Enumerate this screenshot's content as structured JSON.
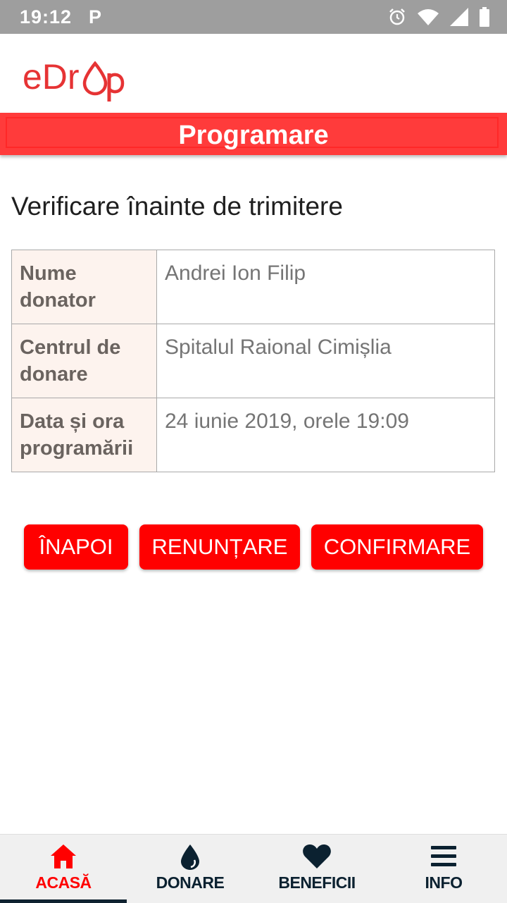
{
  "status_bar": {
    "time": "19:12",
    "notification": "P",
    "icons": [
      "alarm-icon",
      "wifi-icon",
      "signal-icon",
      "battery-icon"
    ]
  },
  "app": {
    "logo_text": "eDrop",
    "brand_color": "#e63334"
  },
  "page": {
    "title": "Programare",
    "heading": "Verificare înainte de trimitere"
  },
  "review": {
    "rows": [
      {
        "label": "Nume donator",
        "value": "Andrei Ion Filip"
      },
      {
        "label": "Centrul de donare",
        "value": "Spitalul Raional Cimișlia"
      },
      {
        "label": "Data și ora programării",
        "value": "24 iunie 2019, orele 19:09"
      }
    ]
  },
  "actions": {
    "back_label": "ÎNAPOI",
    "cancel_label": "RENUNȚARE",
    "confirm_label": "CONFIRMARE",
    "button_color": "#ff0000"
  },
  "bottom_nav": {
    "items": [
      {
        "label": "ACASĂ",
        "icon": "home-icon",
        "active": true
      },
      {
        "label": "DONARE",
        "icon": "drop-icon",
        "active": false
      },
      {
        "label": "BENEFICII",
        "icon": "heart-icon",
        "active": false
      },
      {
        "label": "INFO",
        "icon": "menu-icon",
        "active": false
      }
    ],
    "active_color": "#ff0000"
  }
}
